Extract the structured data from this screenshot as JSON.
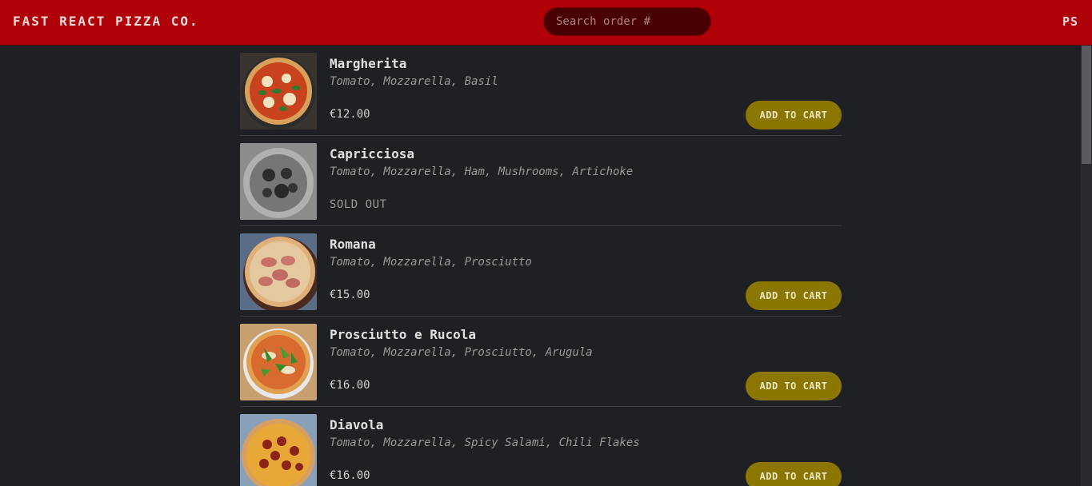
{
  "header": {
    "logo": "FAST REACT PIZZA CO.",
    "search_placeholder": "Search order #",
    "user_initials": "PS"
  },
  "menu": {
    "items": [
      {
        "name": "Margherita",
        "ingredients": "Tomato, Mozzarella, Basil",
        "price": "€12.00",
        "button": "ADD TO CART",
        "sold_out": false,
        "image": "pizza-margherita-image"
      },
      {
        "name": "Capricciosa",
        "ingredients": "Tomato, Mozzarella, Ham, Mushrooms, Artichoke",
        "status": "SOLD OUT",
        "sold_out": true,
        "image": "pizza-capricciosa-image"
      },
      {
        "name": "Romana",
        "ingredients": "Tomato, Mozzarella, Prosciutto",
        "price": "€15.00",
        "button": "ADD TO CART",
        "sold_out": false,
        "image": "pizza-romana-image"
      },
      {
        "name": "Prosciutto e Rucola",
        "ingredients": "Tomato, Mozzarella, Prosciutto, Arugula",
        "price": "€16.00",
        "button": "ADD TO CART",
        "sold_out": false,
        "image": "pizza-prosciutto-rucola-image"
      },
      {
        "name": "Diavola",
        "ingredients": "Tomato, Mozzarella, Spicy Salami, Chili Flakes",
        "price": "€16.00",
        "button": "ADD TO CART",
        "sold_out": false,
        "image": "pizza-diavola-image"
      }
    ]
  },
  "colors": {
    "header_bg": "#b00008",
    "page_bg": "#1f2023",
    "button_bg": "#8a7600"
  }
}
